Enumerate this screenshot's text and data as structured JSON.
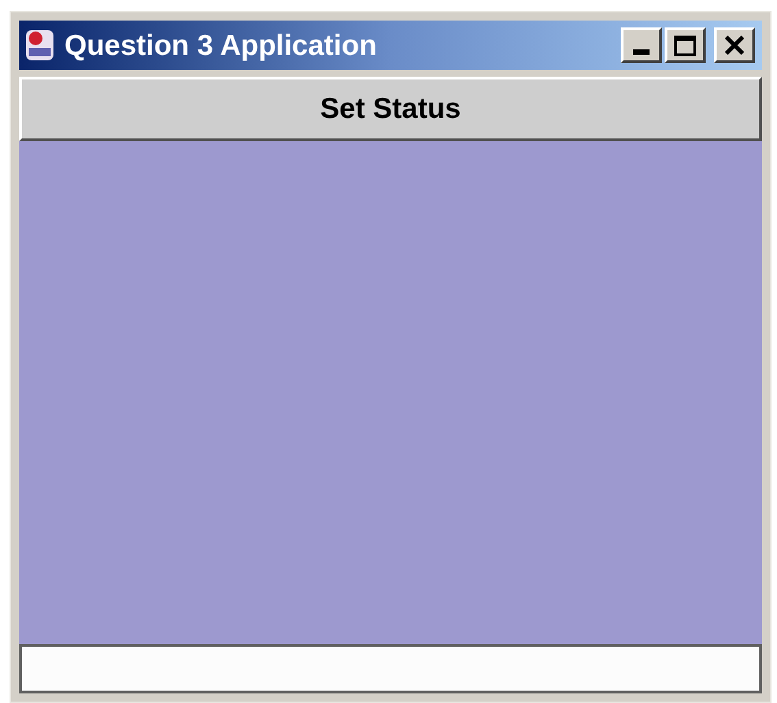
{
  "window": {
    "title": "Question 3 Application"
  },
  "button": {
    "label": "Set Status"
  }
}
